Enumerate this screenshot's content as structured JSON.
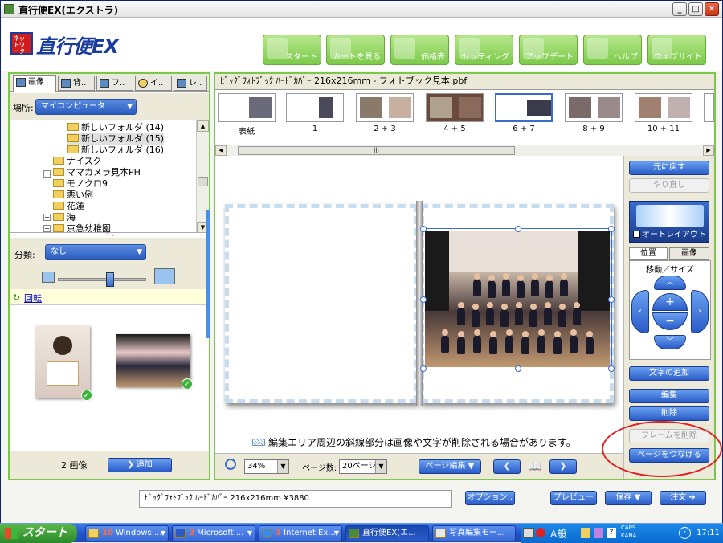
{
  "window": {
    "title": "直行便EX(エクストラ)"
  },
  "header": {
    "logo_badge": "ネットワークキタムラ",
    "logo_text": "直行便EX",
    "nav": [
      {
        "label": "スタート",
        "icon": "house-icon"
      },
      {
        "label": "カートを見る",
        "icon": "cart-icon"
      },
      {
        "label": "価格表",
        "icon": "price-icon"
      },
      {
        "label": "セッティング",
        "icon": "settings-icon"
      },
      {
        "label": "アップデート",
        "icon": "update-icon"
      },
      {
        "label": "ヘルプ",
        "icon": "help-icon"
      },
      {
        "label": "ウェブサイト",
        "icon": "globe-icon"
      }
    ]
  },
  "left": {
    "tabs": [
      "画像",
      "背..",
      "フ..",
      "イ..",
      "レ.."
    ],
    "place_label": "場所:",
    "place_value": "マイコンピュータ",
    "tree": [
      "新しいフォルダ (14)",
      "新しいフォルダ (15)",
      "新しいフォルダ (16)",
      "ナイスク",
      "ママカメラ見本PH",
      "モノクロ9",
      "悪い例",
      "花蓮",
      "海",
      "京急幼稚園"
    ],
    "class_label": "分類:",
    "class_value": "なし",
    "rotate": "回転",
    "count": "2 画像",
    "add": "追加"
  },
  "main": {
    "doc_title": "ﾋﾞｯｸﾞﾌｫﾄﾌﾞｯｸ ﾊｰﾄﾞｶﾊﾞｰ 216x216mm - フォトブック見本.pbf",
    "thumbs": [
      "表紙",
      "1",
      "2 + 3",
      "4 + 5",
      "6 + 7",
      "8 + 9",
      "10 + 11"
    ],
    "notice": "編集エリア周辺の斜線部分は画像や文字が削除される場合があります。",
    "zoom": "34%",
    "pages_label": "ページ数:",
    "pages_value": "20ページ",
    "page_edit": "ページ編集"
  },
  "right": {
    "undo": "元に戻す",
    "redo": "やり直し",
    "auto_layout": "オートレイアウト",
    "tab_position": "位置",
    "tab_image": "画像",
    "move_size": "移動／サイズ",
    "add_text": "文字の追加",
    "edit": "編集",
    "delete": "削除",
    "delete_frame": "フレームを削除",
    "attach_page": "ページをつなげる"
  },
  "bottom": {
    "info": "ﾋﾞｯｸﾞﾌｫﾄﾌﾞｯｸ ﾊｰﾄﾞｶﾊﾞｰ 216x216mm ¥3880",
    "options": "オプション..",
    "preview": "プレビュー",
    "save": "保存",
    "order": "注文"
  },
  "taskbar": {
    "start": "スタート",
    "tasks": [
      {
        "num": "10",
        "label": "Windows ..."
      },
      {
        "num": "2",
        "label": "Microsoft ..."
      },
      {
        "num": "3",
        "label": "Internet Ex..."
      },
      {
        "num": "",
        "label": "直行便EX(エ..."
      },
      {
        "num": "",
        "label": "写真編集モー..."
      }
    ],
    "ime": "A般",
    "caps": "CAPS",
    "kana": "KANA",
    "clock": "17:11"
  }
}
